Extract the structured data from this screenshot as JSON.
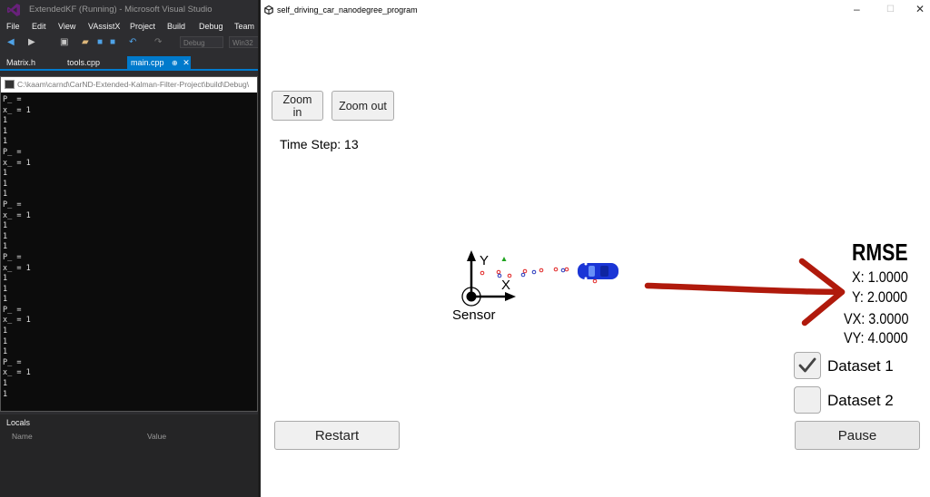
{
  "vs": {
    "title": "ExtendedKF (Running) - Microsoft Visual Studio",
    "menu": [
      "File",
      "Edit",
      "View",
      "VAssistX",
      "Project",
      "Build",
      "Debug",
      "Team"
    ],
    "toolbar": {
      "config": "Debug",
      "platform": "Win32"
    },
    "tabs": [
      "Matrix.h",
      "tools.cpp",
      "main.cpp"
    ],
    "active_tab": "main.cpp",
    "console": {
      "title": "C:\\kaam\\carnd\\CarND-Extended-Kalman-Filter-Project\\build\\Debug\\",
      "lines": [
        "P_ =",
        "x_ = 1",
        "1",
        "1",
        "1",
        "P_ =",
        "x_ = 1",
        "1",
        "1",
        "1",
        "P_ =",
        "x_ = 1",
        "1",
        "1",
        "1",
        "P_ =",
        "x_ = 1",
        "1",
        "1",
        "1",
        "P_ =",
        "x_ = 1",
        "1",
        "1",
        "1",
        "P_ =",
        "x_ = 1",
        "1",
        "1"
      ]
    },
    "locals": {
      "title": "Locals",
      "columns": [
        "Name",
        "Value"
      ]
    }
  },
  "sim": {
    "title": "self_driving_car_nanodegree_program",
    "zoom_in": "Zoom in",
    "zoom_out": "Zoom out",
    "time_step": "Time Step: 13",
    "axes": {
      "y_label": "Y",
      "x_label": "X",
      "sensor_label": "Sensor"
    },
    "rmse": {
      "title": "RMSE",
      "x": "X: 1.0000",
      "y": "Y: 2.0000",
      "vx": "VX: 3.0000",
      "vy": "VY: 4.0000"
    },
    "datasets": [
      {
        "label": "Dataset 1",
        "checked": true
      },
      {
        "label": "Dataset 2",
        "checked": false
      }
    ],
    "restart": "Restart",
    "pause": "Pause",
    "colors": {
      "arrow": "#b01a0c",
      "car": "#1a35d6",
      "laser": "#e02020",
      "radar": "#2233bb",
      "estimate": "#1ea31e",
      "vs_accent": "#007acc"
    }
  }
}
